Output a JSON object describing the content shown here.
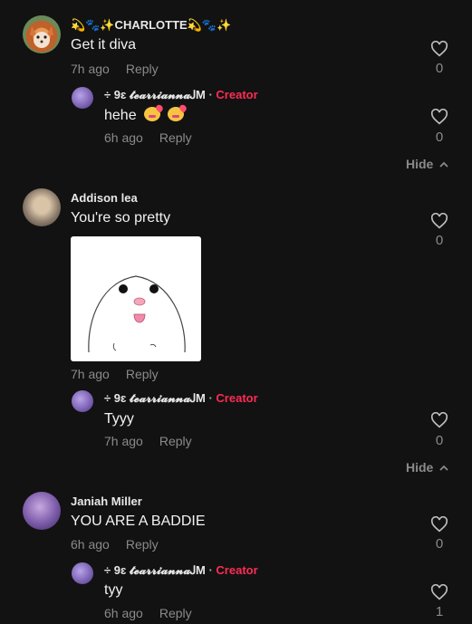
{
  "comments": [
    {
      "user": "💫🐾✨CHARLOTTE💫🐾✨",
      "text": "Get it diva",
      "time": "7h ago",
      "reply_label": "Reply",
      "likes": "0",
      "replies": [
        {
          "user": "÷ 9ɛ 𝓽𝓮𝓪𝓻𝓻𝓲𝓪𝓷𝓷𝓪ᎫM",
          "sep": "·",
          "badge": "Creator",
          "text": "hehe",
          "emoji": [
            "smiling-face-with-hearts-emoji",
            "smiling-face-with-hearts-emoji"
          ],
          "time": "6h ago",
          "reply_label": "Reply",
          "likes": "0"
        }
      ],
      "hide_label": "Hide"
    },
    {
      "user": "Addison lea",
      "text": "You're so pretty",
      "time": "7h ago",
      "reply_label": "Reply",
      "likes": "0",
      "image": "hamster-sticker",
      "replies": [
        {
          "user": "÷ 9ɛ 𝓽𝓮𝓪𝓻𝓻𝓲𝓪𝓷𝓷𝓪ᎫM",
          "sep": "·",
          "badge": "Creator",
          "text": "Tyyy",
          "time": "7h ago",
          "reply_label": "Reply",
          "likes": "0"
        }
      ],
      "hide_label": "Hide"
    },
    {
      "user": "Janiah Miller",
      "text": "YOU ARE A BADDIE",
      "time": "6h ago",
      "reply_label": "Reply",
      "likes": "0",
      "replies": [
        {
          "user": "÷ 9ɛ 𝓽𝓮𝓪𝓻𝓻𝓲𝓪𝓷𝓷𝓪ᎫM",
          "sep": "·",
          "badge": "Creator",
          "text": "tyy",
          "time": "6h ago",
          "reply_label": "Reply",
          "likes": "1"
        }
      ]
    }
  ],
  "colors": {
    "background": "#121212",
    "creator_badge": "#fe2c55",
    "muted": "#8a8a8a"
  }
}
